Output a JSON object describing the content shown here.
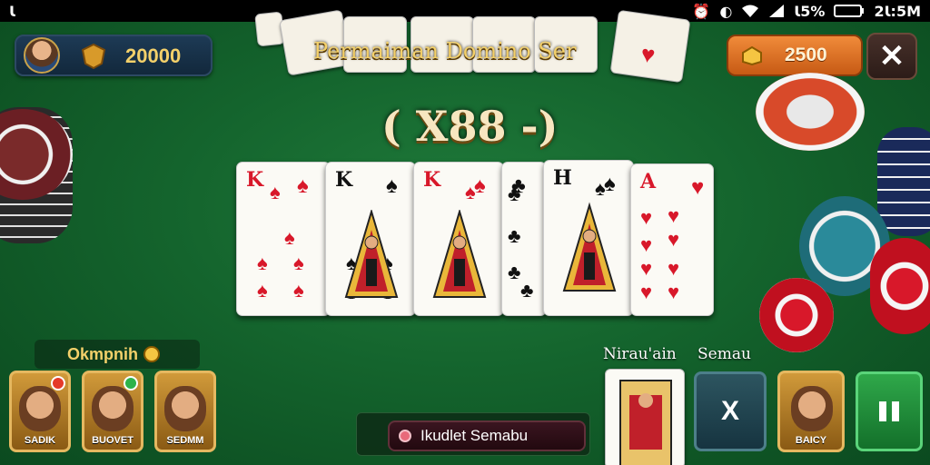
{
  "status_bar": {
    "left_glyph": "Ꙇ",
    "battery_text": "Ꙇ5%",
    "time": "2Ꙇ:5M"
  },
  "player_panel": {
    "coins": "20000"
  },
  "title": "Permaiman Domino Ser",
  "multiplier": "( X88 -)",
  "wallet": {
    "amount": "2500"
  },
  "hand": [
    {
      "rank": "K",
      "suit": "♠",
      "color": "red"
    },
    {
      "rank": "K",
      "suit": "♠",
      "color": "black"
    },
    {
      "rank": "K",
      "suit": "♠",
      "color": "red"
    },
    {
      "rank": "",
      "suit": "♣",
      "color": "black"
    },
    {
      "rank": "H",
      "suit": "♠",
      "color": "black"
    },
    {
      "rank": "A",
      "suit": "♥",
      "color": "red"
    }
  ],
  "opponents": {
    "label": "Okmpnih",
    "players": [
      {
        "name": "SADIK"
      },
      {
        "name": "BUOVET"
      },
      {
        "name": "SEDMM"
      }
    ]
  },
  "action_labels": {
    "left": "Nirau'ain",
    "right": "Semau"
  },
  "actions": {
    "x_label": "X"
  },
  "self_player": {
    "name": "BAICY"
  },
  "message": "Ikudlet Semabu",
  "colors": {
    "felt": "#14642d",
    "gold_text": "#f3d06a",
    "red_suit": "#d8182a",
    "accent_orange": "#e57a2a"
  }
}
